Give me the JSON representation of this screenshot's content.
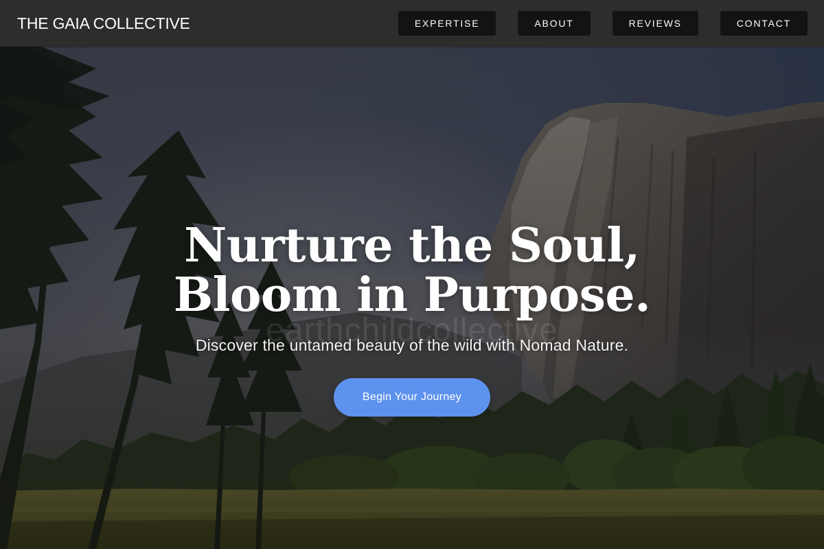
{
  "navbar": {
    "brand": "THE GAIA COLLECTIVE",
    "links": [
      {
        "label": "EXPERTISE"
      },
      {
        "label": "ABOUT"
      },
      {
        "label": "REVIEWS"
      },
      {
        "label": "CONTACT"
      }
    ]
  },
  "hero": {
    "title_line_1": "Nurture the Soul,",
    "title_line_2": "Bloom in Purpose.",
    "subtitle": "Discover the untamed beauty of the wild with Nomad Nature.",
    "cta_label": "Begin Your Journey",
    "watermark": "earthchildcollective",
    "background_image": "yosemite-el-capitan-forest-meadow-photo"
  },
  "colors": {
    "navbar_bg": "#2d2d2c",
    "nav_button_bg": "#131313",
    "cta_bg": "#5e92ef",
    "text": "#ffffff"
  }
}
